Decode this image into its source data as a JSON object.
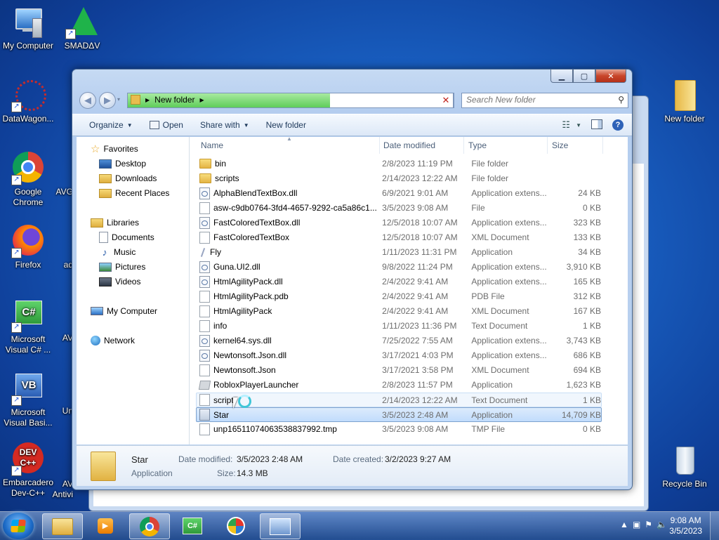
{
  "desktop": {
    "icons_left": [
      {
        "label": "My Computer"
      },
      {
        "label": "SMADΔV"
      },
      {
        "label": "DataWagon..."
      },
      {
        "label": "Google Chrome"
      },
      {
        "label": "Firefox"
      },
      {
        "label": "Microsoft Visual C# ..."
      },
      {
        "label": "Microsoft Visual Basi..."
      },
      {
        "label": "Embarcadero Dev-C++"
      }
    ],
    "partial_labels": [
      "AVG",
      "ad",
      "AV",
      "Un",
      "AV Antivi"
    ],
    "icons_right": [
      {
        "label": "New folder"
      },
      {
        "label": "Recycle Bin"
      }
    ]
  },
  "window": {
    "breadcrumb": "New folder",
    "search_placeholder": "Search New folder",
    "toolbar": {
      "organize": "Organize",
      "open": "Open",
      "share_with": "Share with",
      "new_folder": "New folder"
    },
    "nav": {
      "favorites": "Favorites",
      "desktop": "Desktop",
      "downloads": "Downloads",
      "recent_places": "Recent Places",
      "libraries": "Libraries",
      "documents": "Documents",
      "music": "Music",
      "pictures": "Pictures",
      "videos": "Videos",
      "my_computer": "My Computer",
      "network": "Network"
    },
    "columns": {
      "name": "Name",
      "date": "Date modified",
      "type": "Type",
      "size": "Size"
    },
    "files": [
      {
        "name": "bin",
        "date": "2/8/2023 11:19 PM",
        "type": "File folder",
        "size": ""
      },
      {
        "name": "scripts",
        "date": "2/14/2023 12:22 AM",
        "type": "File folder",
        "size": ""
      },
      {
        "name": "AlphaBlendTextBox.dll",
        "date": "6/9/2021 9:01 AM",
        "type": "Application extens...",
        "size": "24 KB"
      },
      {
        "name": "asw-c9db0764-3fd4-4657-9292-ca5a86c1...",
        "date": "3/5/2023 9:08 AM",
        "type": "File",
        "size": "0 KB"
      },
      {
        "name": "FastColoredTextBox.dll",
        "date": "12/5/2018 10:07 AM",
        "type": "Application extens...",
        "size": "323 KB"
      },
      {
        "name": "FastColoredTextBox",
        "date": "12/5/2018 10:07 AM",
        "type": "XML Document",
        "size": "133 KB"
      },
      {
        "name": "Fly",
        "date": "1/11/2023 11:31 PM",
        "type": "Application",
        "size": "34 KB"
      },
      {
        "name": "Guna.UI2.dll",
        "date": "9/8/2022 11:24 PM",
        "type": "Application extens...",
        "size": "3,910 KB"
      },
      {
        "name": "HtmlAgilityPack.dll",
        "date": "2/4/2022 9:41 AM",
        "type": "Application extens...",
        "size": "165 KB"
      },
      {
        "name": "HtmlAgilityPack.pdb",
        "date": "2/4/2022 9:41 AM",
        "type": "PDB File",
        "size": "312 KB"
      },
      {
        "name": "HtmlAgilityPack",
        "date": "2/4/2022 9:41 AM",
        "type": "XML Document",
        "size": "167 KB"
      },
      {
        "name": "info",
        "date": "1/11/2023 11:36 PM",
        "type": "Text Document",
        "size": "1 KB"
      },
      {
        "name": "kernel64.sys.dll",
        "date": "7/25/2022 7:55 AM",
        "type": "Application extens...",
        "size": "3,743 KB"
      },
      {
        "name": "Newtonsoft.Json.dll",
        "date": "3/17/2021 4:03 PM",
        "type": "Application extens...",
        "size": "686 KB"
      },
      {
        "name": "Newtonsoft.Json",
        "date": "3/17/2021 3:58 PM",
        "type": "XML Document",
        "size": "694 KB"
      },
      {
        "name": "RobloxPlayerLauncher",
        "date": "2/8/2023 11:57 PM",
        "type": "Application",
        "size": "1,623 KB"
      },
      {
        "name": "script",
        "date": "2/14/2023 12:22 AM",
        "type": "Text Document",
        "size": "1 KB"
      },
      {
        "name": "Star",
        "date": "3/5/2023 2:48 AM",
        "type": "Application",
        "size": "14,709 KB"
      },
      {
        "name": "unp16511074063538837992.tmp",
        "date": "3/5/2023 9:08 AM",
        "type": "TMP File",
        "size": "0 KB"
      }
    ],
    "details": {
      "name": "Star",
      "type": "Application",
      "date_modified_label": "Date modified:",
      "date_modified": "3/5/2023 2:48 AM",
      "date_created_label": "Date created:",
      "date_created": "3/2/2023 9:27 AM",
      "size_label": "Size:",
      "size": "14.3 MB"
    }
  },
  "taskbar": {
    "time": "9:08 AM",
    "date": "3/5/2023"
  },
  "colors": {
    "selection": "#c1dcfc",
    "progress": "#5fcd5a",
    "close_button": "#c8452a"
  }
}
